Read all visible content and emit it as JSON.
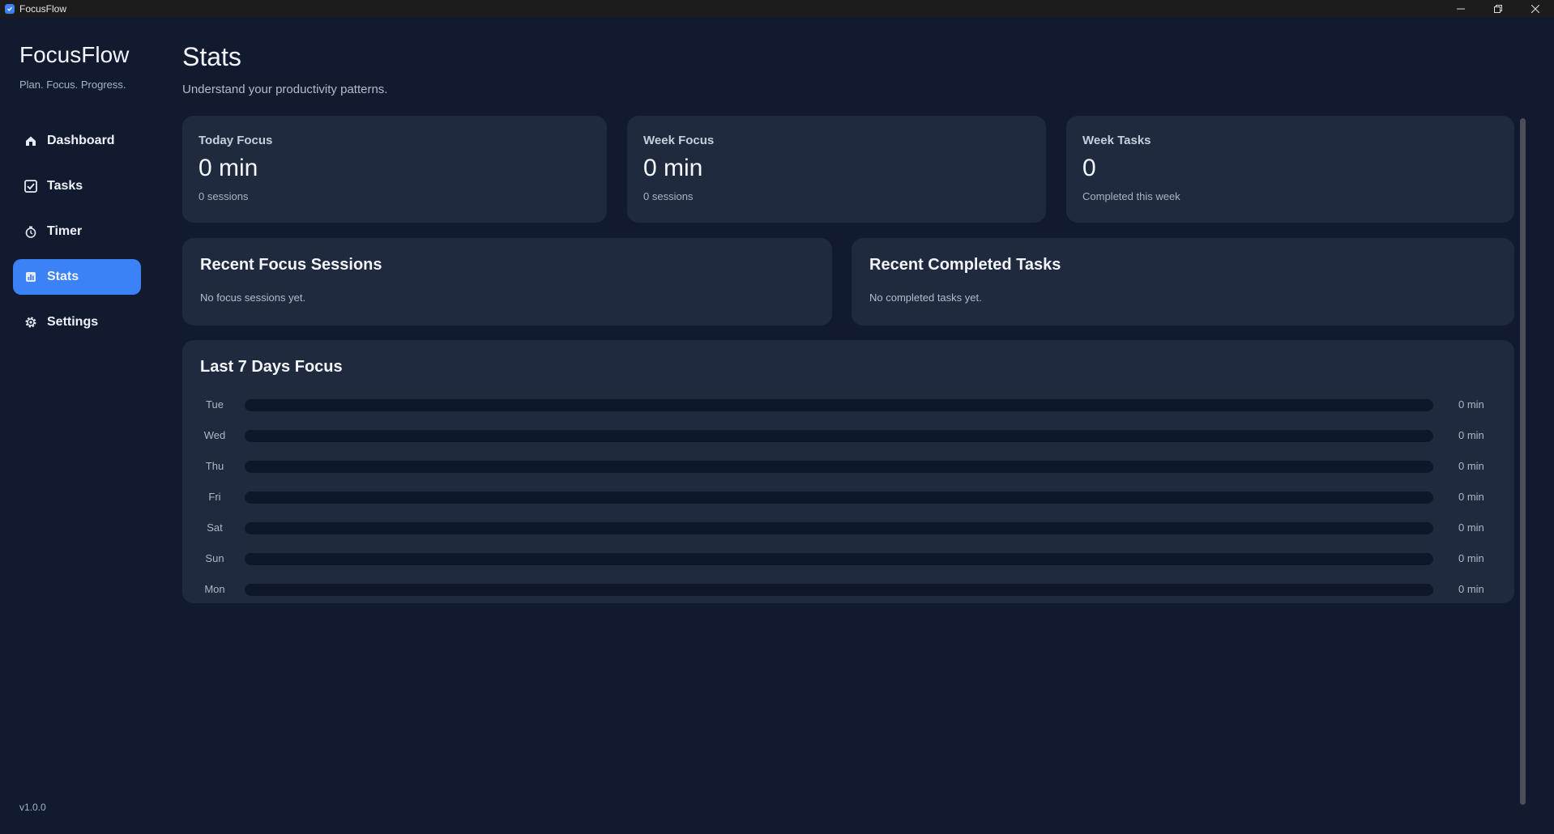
{
  "window": {
    "title": "FocusFlow",
    "minimize_label": "─",
    "maximize_label": "❐",
    "close_label": "✕"
  },
  "sidebar": {
    "brand": "FocusFlow",
    "tagline": "Plan. Focus. Progress.",
    "items": [
      {
        "label": "Dashboard",
        "icon": "home-icon",
        "active": false
      },
      {
        "label": "Tasks",
        "icon": "checkbox-icon",
        "active": false
      },
      {
        "label": "Timer",
        "icon": "stopwatch-icon",
        "active": false
      },
      {
        "label": "Stats",
        "icon": "chart-icon",
        "active": true
      },
      {
        "label": "Settings",
        "icon": "gear-icon",
        "active": false
      }
    ],
    "version": "v1.0.0"
  },
  "page": {
    "title": "Stats",
    "subtitle": "Understand your productivity patterns."
  },
  "stats": [
    {
      "label": "Today Focus",
      "value": "0 min",
      "sub": "0 sessions"
    },
    {
      "label": "Week Focus",
      "value": "0 min",
      "sub": "0 sessions"
    },
    {
      "label": "Week Tasks",
      "value": "0",
      "sub": "Completed this week"
    }
  ],
  "recent_sessions": {
    "title": "Recent Focus Sessions",
    "empty": "No focus sessions yet."
  },
  "recent_tasks": {
    "title": "Recent Completed Tasks",
    "empty": "No completed tasks yet."
  },
  "last7": {
    "title": "Last 7 Days Focus",
    "days": [
      {
        "day": "Tue",
        "value": "0 min",
        "fraction": 0
      },
      {
        "day": "Wed",
        "value": "0 min",
        "fraction": 0
      },
      {
        "day": "Thu",
        "value": "0 min",
        "fraction": 0
      },
      {
        "day": "Fri",
        "value": "0 min",
        "fraction": 0
      },
      {
        "day": "Sat",
        "value": "0 min",
        "fraction": 0
      },
      {
        "day": "Sun",
        "value": "0 min",
        "fraction": 0
      },
      {
        "day": "Mon",
        "value": "0 min",
        "fraction": 0
      }
    ]
  },
  "colors": {
    "accent": "#3b82f6",
    "background": "#111a2e",
    "card": "#1f2a3f",
    "track": "#0f182b"
  }
}
